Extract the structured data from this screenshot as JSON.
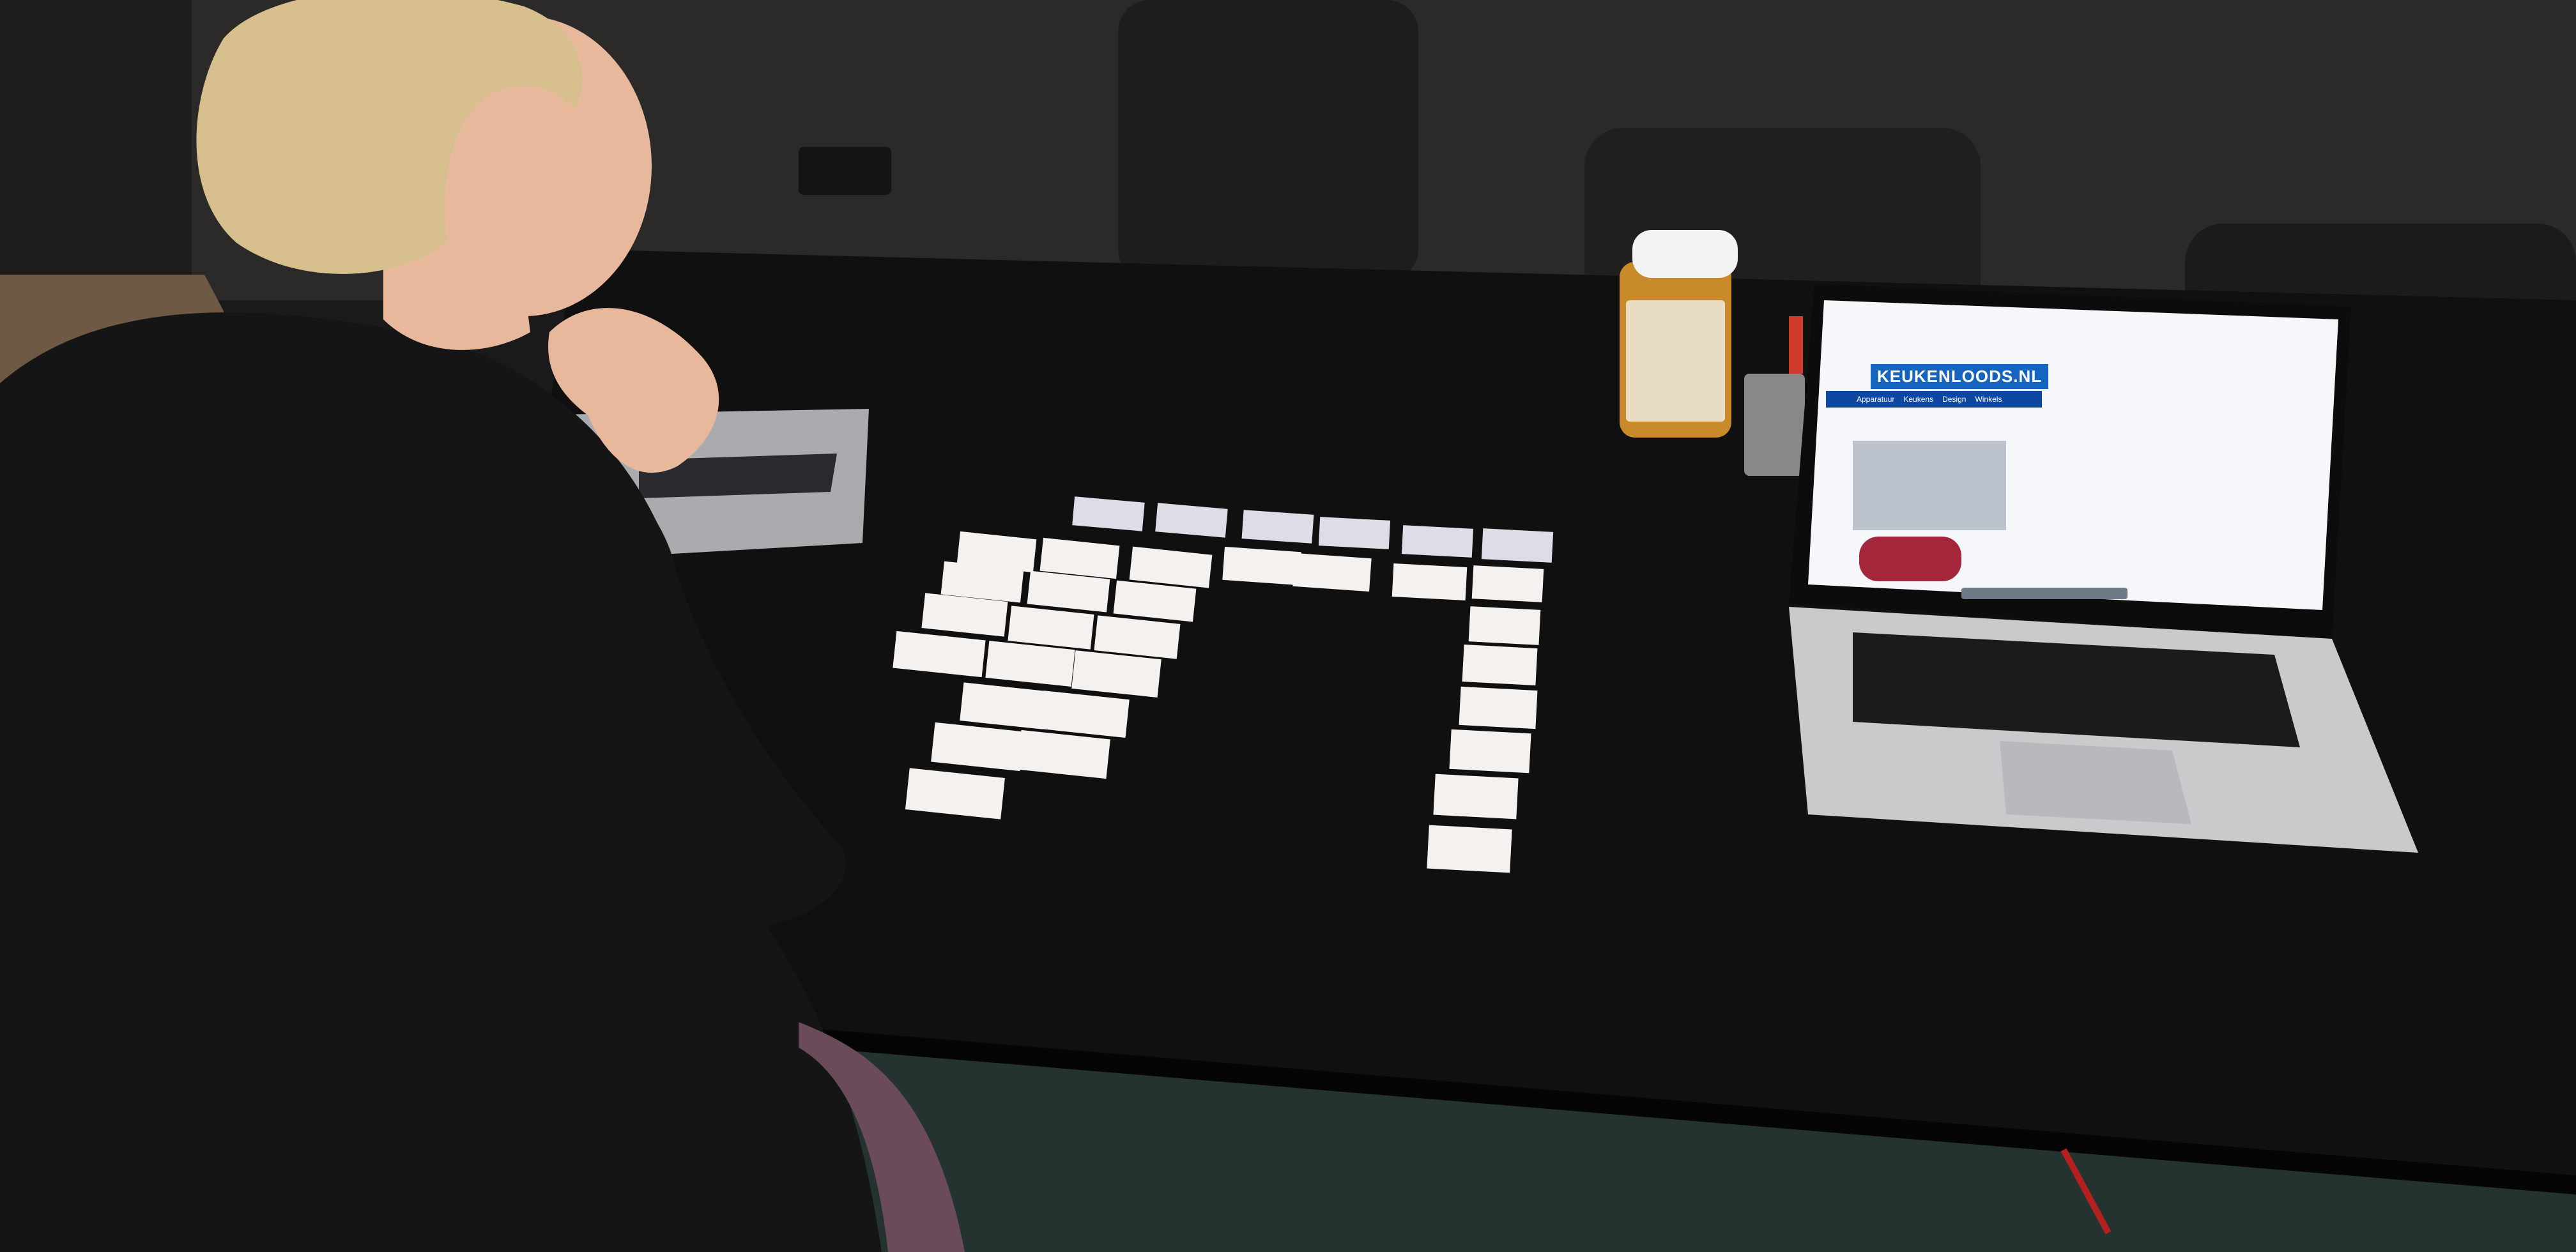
{
  "scene": {
    "description_free": true,
    "colors": {
      "wall": "#2c2a28",
      "table": "#111111",
      "card": "#f4f1ee",
      "card_header": "#dcdde6",
      "laptop_body": "#c9cacc",
      "screen": "#f5f7fb",
      "brand_blue": "#1565c0",
      "brand_orange": "#f28c00",
      "jar_label": "#e8dcc2",
      "jar_contents": "#c98a2a",
      "skin": "#e7b89c",
      "hair": "#d8c08e",
      "jacket": "#151515"
    }
  },
  "laptop_screen": {
    "logo": "KEUKENLOODS.NL",
    "nav_items": [
      "Apparatuur",
      "Keukens",
      "Design",
      "Winkels"
    ],
    "icons": [
      "home-icon",
      "dock-icon"
    ]
  }
}
